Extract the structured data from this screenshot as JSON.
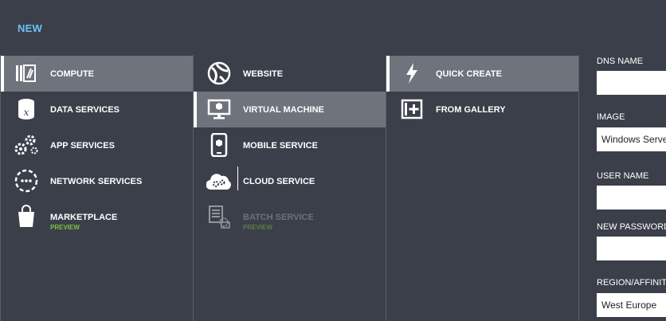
{
  "header": {
    "title": "NEW"
  },
  "categories": [
    {
      "label": "COMPUTE",
      "icon": "compute-icon",
      "selected": true
    },
    {
      "label": "DATA SERVICES",
      "icon": "data-services-icon"
    },
    {
      "label": "APP SERVICES",
      "icon": "app-services-icon"
    },
    {
      "label": "NETWORK SERVICES",
      "icon": "network-services-icon"
    },
    {
      "label": "MARKETPLACE",
      "sub": "PREVIEW",
      "icon": "marketplace-icon"
    }
  ],
  "services": [
    {
      "label": "WEBSITE",
      "icon": "website-icon"
    },
    {
      "label": "VIRTUAL MACHINE",
      "icon": "virtual-machine-icon",
      "selected": true
    },
    {
      "label": "MOBILE SERVICE",
      "icon": "mobile-service-icon"
    },
    {
      "label": "CLOUD SERVICE",
      "icon": "cloud-service-icon"
    },
    {
      "label": "BATCH SERVICE",
      "sub": "PREVIEW",
      "icon": "batch-service-icon",
      "disabled": true
    }
  ],
  "create_options": [
    {
      "label": "QUICK CREATE",
      "icon": "lightning-icon",
      "selected": true
    },
    {
      "label": "FROM GALLERY",
      "icon": "gallery-add-icon"
    }
  ],
  "form": {
    "dns_name": {
      "label": "DNS NAME",
      "value": ""
    },
    "image": {
      "label": "IMAGE",
      "value": "Windows Serve"
    },
    "user_name": {
      "label": "USER NAME",
      "value": ""
    },
    "new_password": {
      "label": "NEW PASSWORD",
      "value": ""
    },
    "region": {
      "label": "REGION/AFFINITY",
      "value": "West Europe"
    }
  },
  "colors": {
    "background": "#3b3f4a",
    "selected": "#6f737c",
    "accent": "#69c1f4",
    "preview": "#7bc142"
  }
}
